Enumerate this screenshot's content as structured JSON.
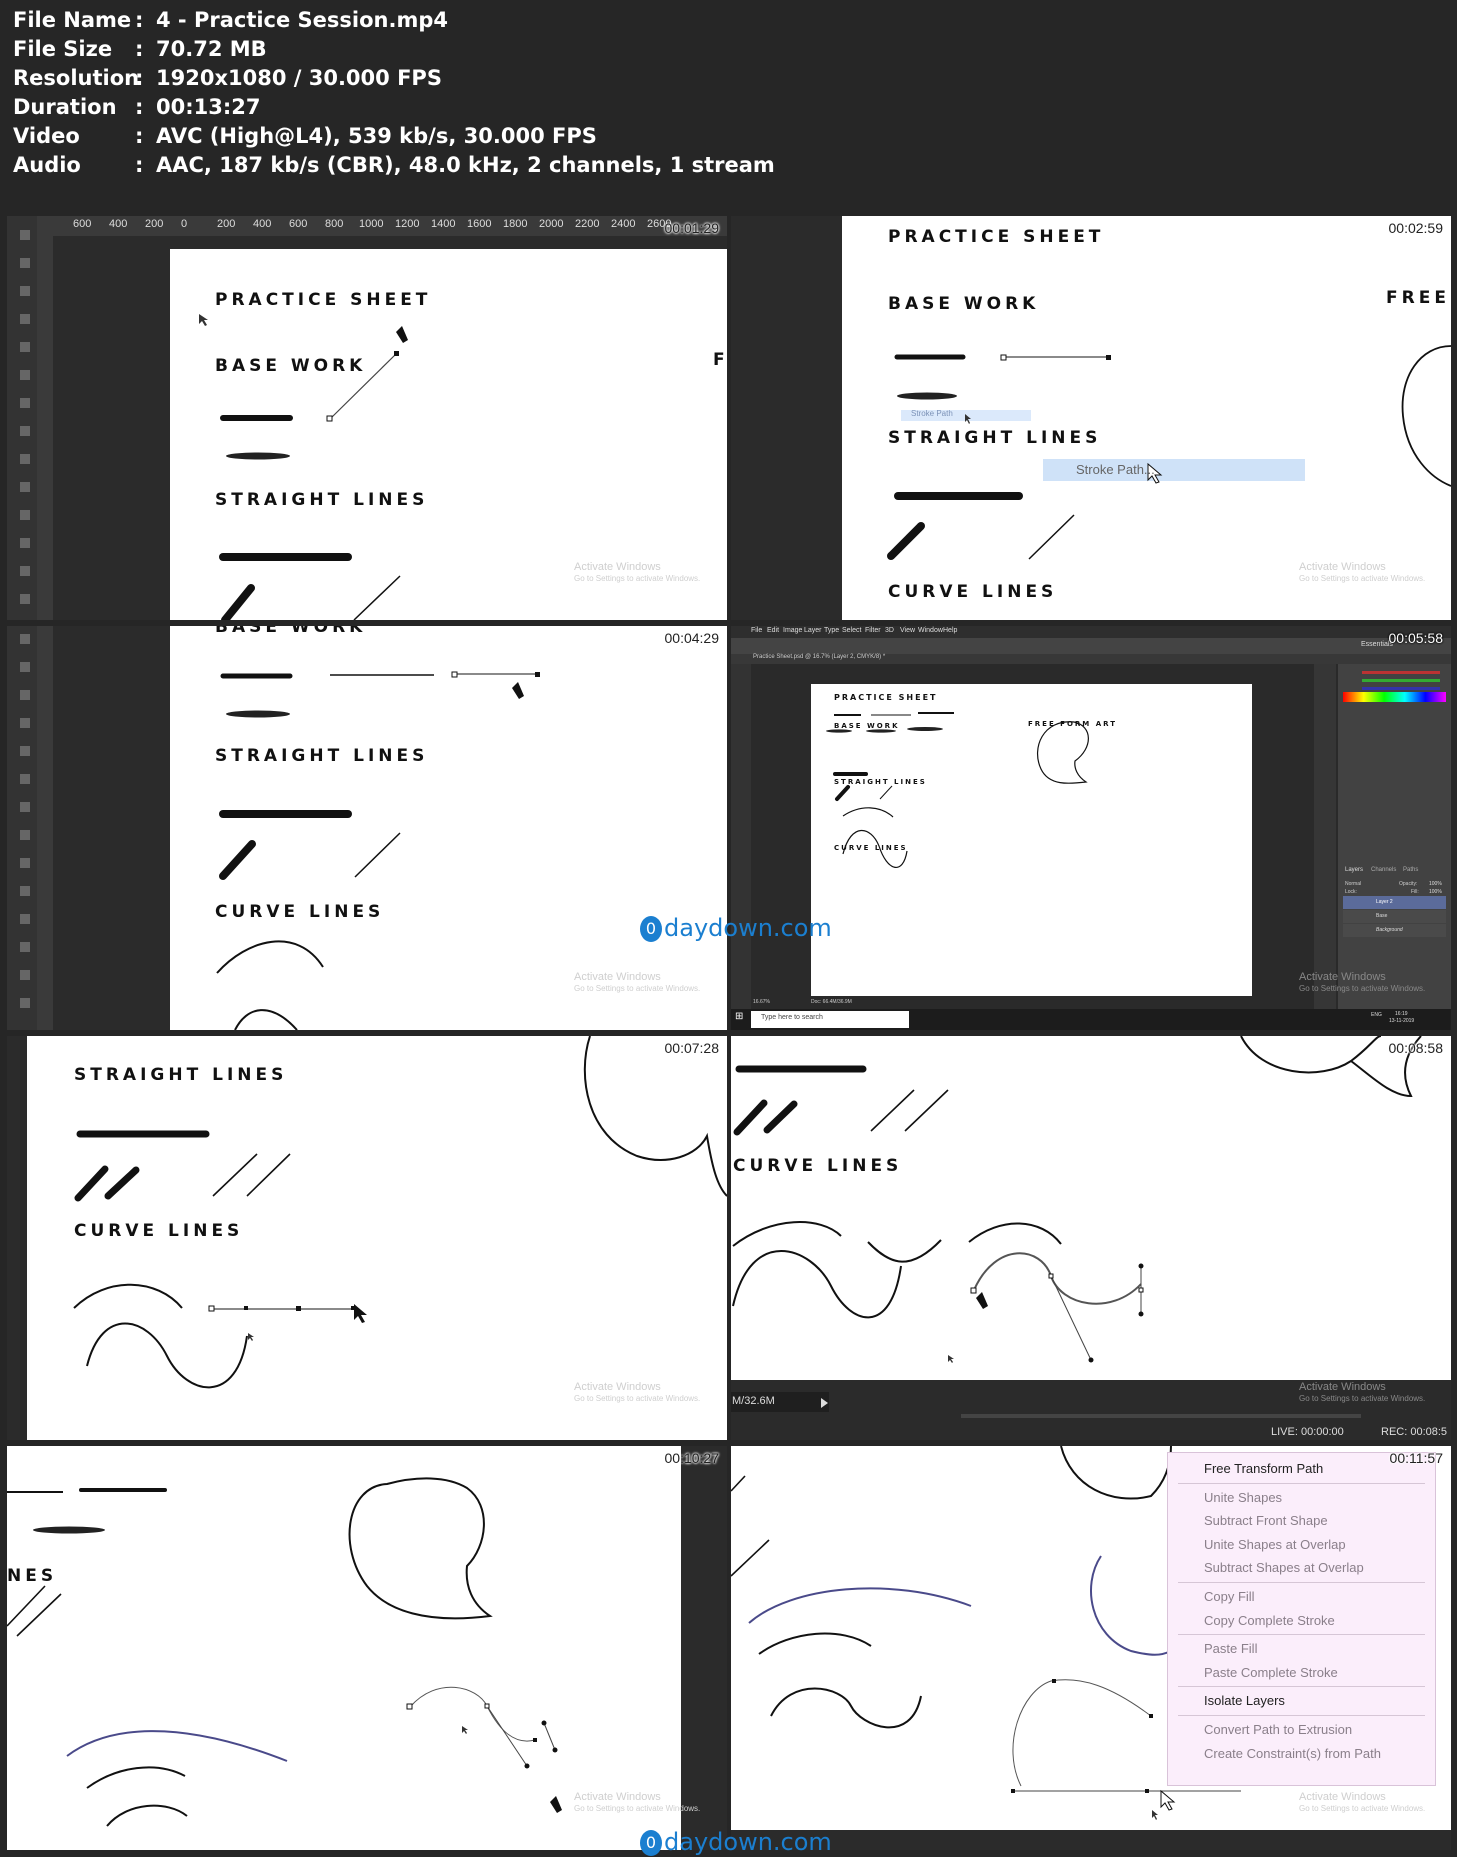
{
  "info": [
    {
      "key": "File Name",
      "value": "4 - Practice Session.mp4"
    },
    {
      "key": "File Size",
      "value": "70.72 MB"
    },
    {
      "key": "Resolution",
      "value": "1920x1080 / 30.000 FPS"
    },
    {
      "key": "Duration",
      "value": "00:13:27"
    },
    {
      "key": "Video",
      "value": "AVC (High@L4), 539 kb/s, 30.000 FPS"
    },
    {
      "key": "Audio",
      "value": "AAC, 187 kb/s (CBR), 48.0 kHz, 2 channels, 1 stream"
    }
  ],
  "separator": ":",
  "thumbnails": [
    {
      "timestamp": "00:01:29"
    },
    {
      "timestamp": "00:02:59"
    },
    {
      "timestamp": "00:04:29"
    },
    {
      "timestamp": "00:05:58"
    },
    {
      "timestamp": "00:07:28"
    },
    {
      "timestamp": "00:08:58"
    },
    {
      "timestamp": "00:10:27"
    },
    {
      "timestamp": "00:11:57"
    }
  ],
  "sheet": {
    "practice_sheet": "PRACTICE SHEET",
    "base_work": "BASE WORK",
    "straight_lines": "STRAIGHT LINES",
    "curve_lines": "CURVE LINES",
    "free_form_art": "FREE FORM ART",
    "free": "FREE",
    "f": "F",
    "nes": "NES"
  },
  "ruler_labels": [
    "600",
    "400",
    "200",
    "0",
    "200",
    "400",
    "600",
    "800",
    "1000",
    "1200",
    "1400",
    "1600",
    "1800",
    "2000",
    "2200",
    "2400",
    "2600"
  ],
  "stroke_path": "Stroke Path...",
  "stroke_path_small": "Stroke Path",
  "watermark": {
    "line1": "Activate Windows",
    "line2": "Go to Settings to activate Windows."
  },
  "ps_window": {
    "menu": [
      "File",
      "Edit",
      "Image",
      "Layer",
      "Type",
      "Select",
      "Filter",
      "3D",
      "View",
      "Window",
      "Help"
    ],
    "doc_tab": "Practice Sheet.psd @ 16.7% (Layer 2, CMYK/8) *",
    "zoom": "16.67%",
    "doc_size": "Doc: 66.4M/36.9M",
    "search": "Type here to search",
    "clock": "16:19",
    "date": "13-11-2019",
    "lang": "ENG",
    "layers": [
      "Layer 2",
      "Base",
      "Background"
    ],
    "panel_tabs": [
      "Layers",
      "Channels",
      "Paths"
    ],
    "blend": "Normal",
    "opacity_label": "Opacity:",
    "opacity": "100%",
    "fill_label": "Fill:",
    "fill": "100%",
    "lock_label": "Lock:",
    "essentials": "Essentials"
  },
  "status_bar": {
    "size": "M/32.6M",
    "live": "LIVE: 00:00:00",
    "rec": "REC: 00:08:5"
  },
  "context_menu": [
    {
      "label": "Free Transform Path",
      "enabled": true
    },
    {
      "sep": true
    },
    {
      "label": "Unite Shapes",
      "enabled": false
    },
    {
      "label": "Subtract Front Shape",
      "enabled": false
    },
    {
      "label": "Unite Shapes at Overlap",
      "enabled": false
    },
    {
      "label": "Subtract Shapes at Overlap",
      "enabled": false
    },
    {
      "sep": true
    },
    {
      "label": "Copy Fill",
      "enabled": false
    },
    {
      "label": "Copy Complete Stroke",
      "enabled": false
    },
    {
      "sep": true
    },
    {
      "label": "Paste Fill",
      "enabled": false
    },
    {
      "label": "Paste Complete Stroke",
      "enabled": false
    },
    {
      "sep": true
    },
    {
      "label": "Isolate Layers",
      "enabled": true
    },
    {
      "sep": true
    },
    {
      "label": "Convert Path to Extrusion",
      "enabled": false
    },
    {
      "label": "Create Constraint(s) from Path",
      "enabled": false
    }
  ],
  "logo": {
    "letter": "0",
    "text": "daydown.com"
  }
}
